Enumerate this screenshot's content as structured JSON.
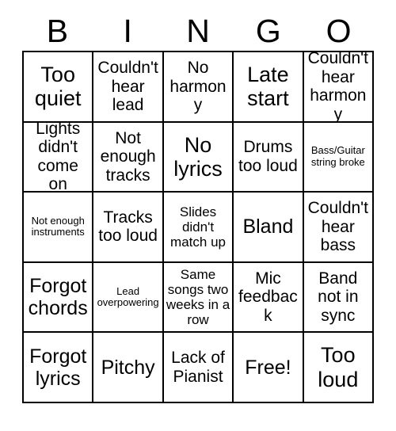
{
  "card": {
    "header_letters": [
      "B",
      "I",
      "N",
      "G",
      "O"
    ],
    "rows": [
      [
        {
          "text": "Too quiet",
          "size": "xl"
        },
        {
          "text": "Couldn't hear lead",
          "size": "md"
        },
        {
          "text": "No harmony",
          "size": "md"
        },
        {
          "text": "Late start",
          "size": "xl"
        },
        {
          "text": "Couldn't hear harmony",
          "size": "md"
        }
      ],
      [
        {
          "text": "Lights didn't come on",
          "size": "md"
        },
        {
          "text": "Not enough tracks",
          "size": "md"
        },
        {
          "text": "No lyrics",
          "size": "xl"
        },
        {
          "text": "Drums too loud",
          "size": "md"
        },
        {
          "text": "Bass/Guitar string broke",
          "size": "xs"
        }
      ],
      [
        {
          "text": "Not enough instruments",
          "size": "xs"
        },
        {
          "text": "Tracks too loud",
          "size": "md"
        },
        {
          "text": "Slides didn't match up",
          "size": "sm"
        },
        {
          "text": "Bland",
          "size": "lg"
        },
        {
          "text": "Couldn't hear bass",
          "size": "md"
        }
      ],
      [
        {
          "text": "Forgot chords",
          "size": "lg"
        },
        {
          "text": "Lead overpowering",
          "size": "xs"
        },
        {
          "text": "Same songs two weeks in a row",
          "size": "sm"
        },
        {
          "text": "Mic feedback",
          "size": "md"
        },
        {
          "text": "Band not in sync",
          "size": "md"
        }
      ],
      [
        {
          "text": "Forgot lyrics",
          "size": "lg"
        },
        {
          "text": "Pitchy",
          "size": "lg"
        },
        {
          "text": "Lack of Pianist",
          "size": "md"
        },
        {
          "text": "Free!",
          "size": "lg"
        },
        {
          "text": "Too loud",
          "size": "xl"
        }
      ]
    ]
  },
  "colors": {
    "border": "#000000",
    "background": "#ffffff",
    "text": "#000000"
  }
}
